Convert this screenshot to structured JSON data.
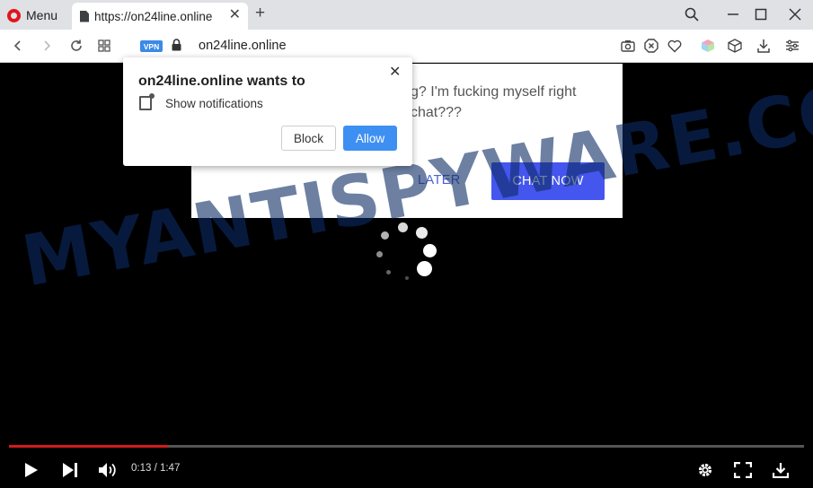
{
  "browser": {
    "menu_label": "Menu",
    "tab_title": "https://on24line.online",
    "url": "on24line.online",
    "vpn_label": "VPN"
  },
  "chat_ad": {
    "message": "g? I'm fucking myself right chat???",
    "later_label": "LATER",
    "chat_now_label": "CHAT NOW"
  },
  "notification": {
    "title": "on24line.online wants to",
    "permission_text": "Show notifications",
    "block_label": "Block",
    "allow_label": "Allow",
    "close_glyph": "✕"
  },
  "video": {
    "time_display": "0:13 / 1:47",
    "progress": 0.2
  },
  "watermark": "MYANTISPYWARE.COM",
  "colors": {
    "opera_red": "#e0151d",
    "vpn_blue": "#3b8ae6",
    "allow_blue": "#3e8ff2",
    "chat_now_blue": "#4556ee",
    "progress_red": "#d11c1c"
  }
}
